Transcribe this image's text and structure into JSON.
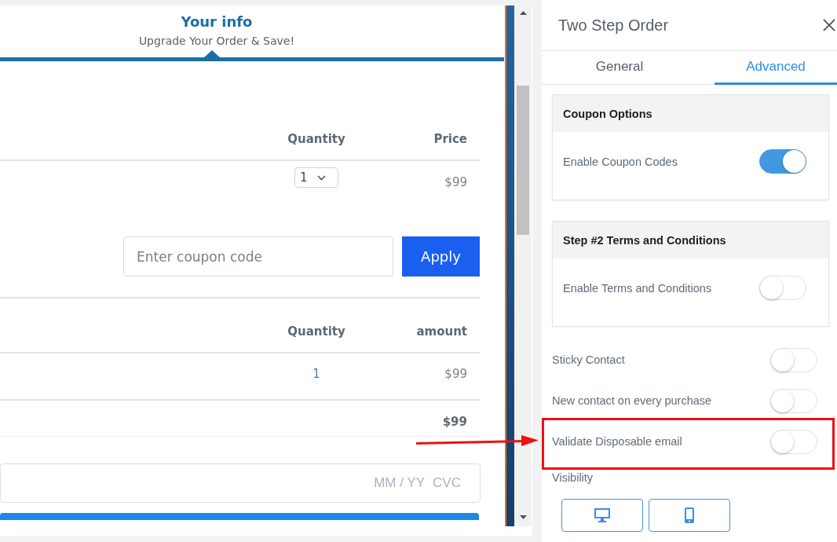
{
  "preview": {
    "step": {
      "title": "Your info",
      "subtitle": "Upgrade Your Order & Save!"
    },
    "order_table": {
      "columns": [
        "Quantity",
        "Price"
      ],
      "rows": [
        {
          "quantity": "1",
          "price": "$99"
        }
      ]
    },
    "coupon": {
      "placeholder": "Enter coupon code",
      "button": "Apply"
    },
    "summary_table": {
      "columns": [
        "Quantity",
        "amount"
      ],
      "rows": [
        {
          "quantity": "1",
          "amount": "$99"
        }
      ],
      "total": "$99"
    },
    "card_field": {
      "expiry_placeholder": "MM / YY",
      "cvc_placeholder": "CVC"
    }
  },
  "panel": {
    "title": "Two Step Order",
    "tabs": [
      {
        "label": "General",
        "selected": false
      },
      {
        "label": "Advanced",
        "selected": true
      }
    ],
    "sections": [
      {
        "title": "Coupon Options",
        "toggles": [
          {
            "label": "Enable Coupon Codes",
            "on": true
          }
        ]
      },
      {
        "title": "Step #2 Terms and Conditions",
        "toggles": [
          {
            "label": "Enable Terms and Conditions",
            "on": false
          }
        ]
      }
    ],
    "settings": [
      {
        "label": "Sticky Contact",
        "on": false,
        "highlighted": false
      },
      {
        "label": "New contact on every purchase",
        "on": false,
        "highlighted": false
      },
      {
        "label": "Validate Disposable email",
        "on": false,
        "highlighted": true
      }
    ],
    "visibility": {
      "label": "Visibility",
      "options": [
        {
          "kind": "desktop"
        },
        {
          "kind": "mobile"
        }
      ]
    }
  }
}
